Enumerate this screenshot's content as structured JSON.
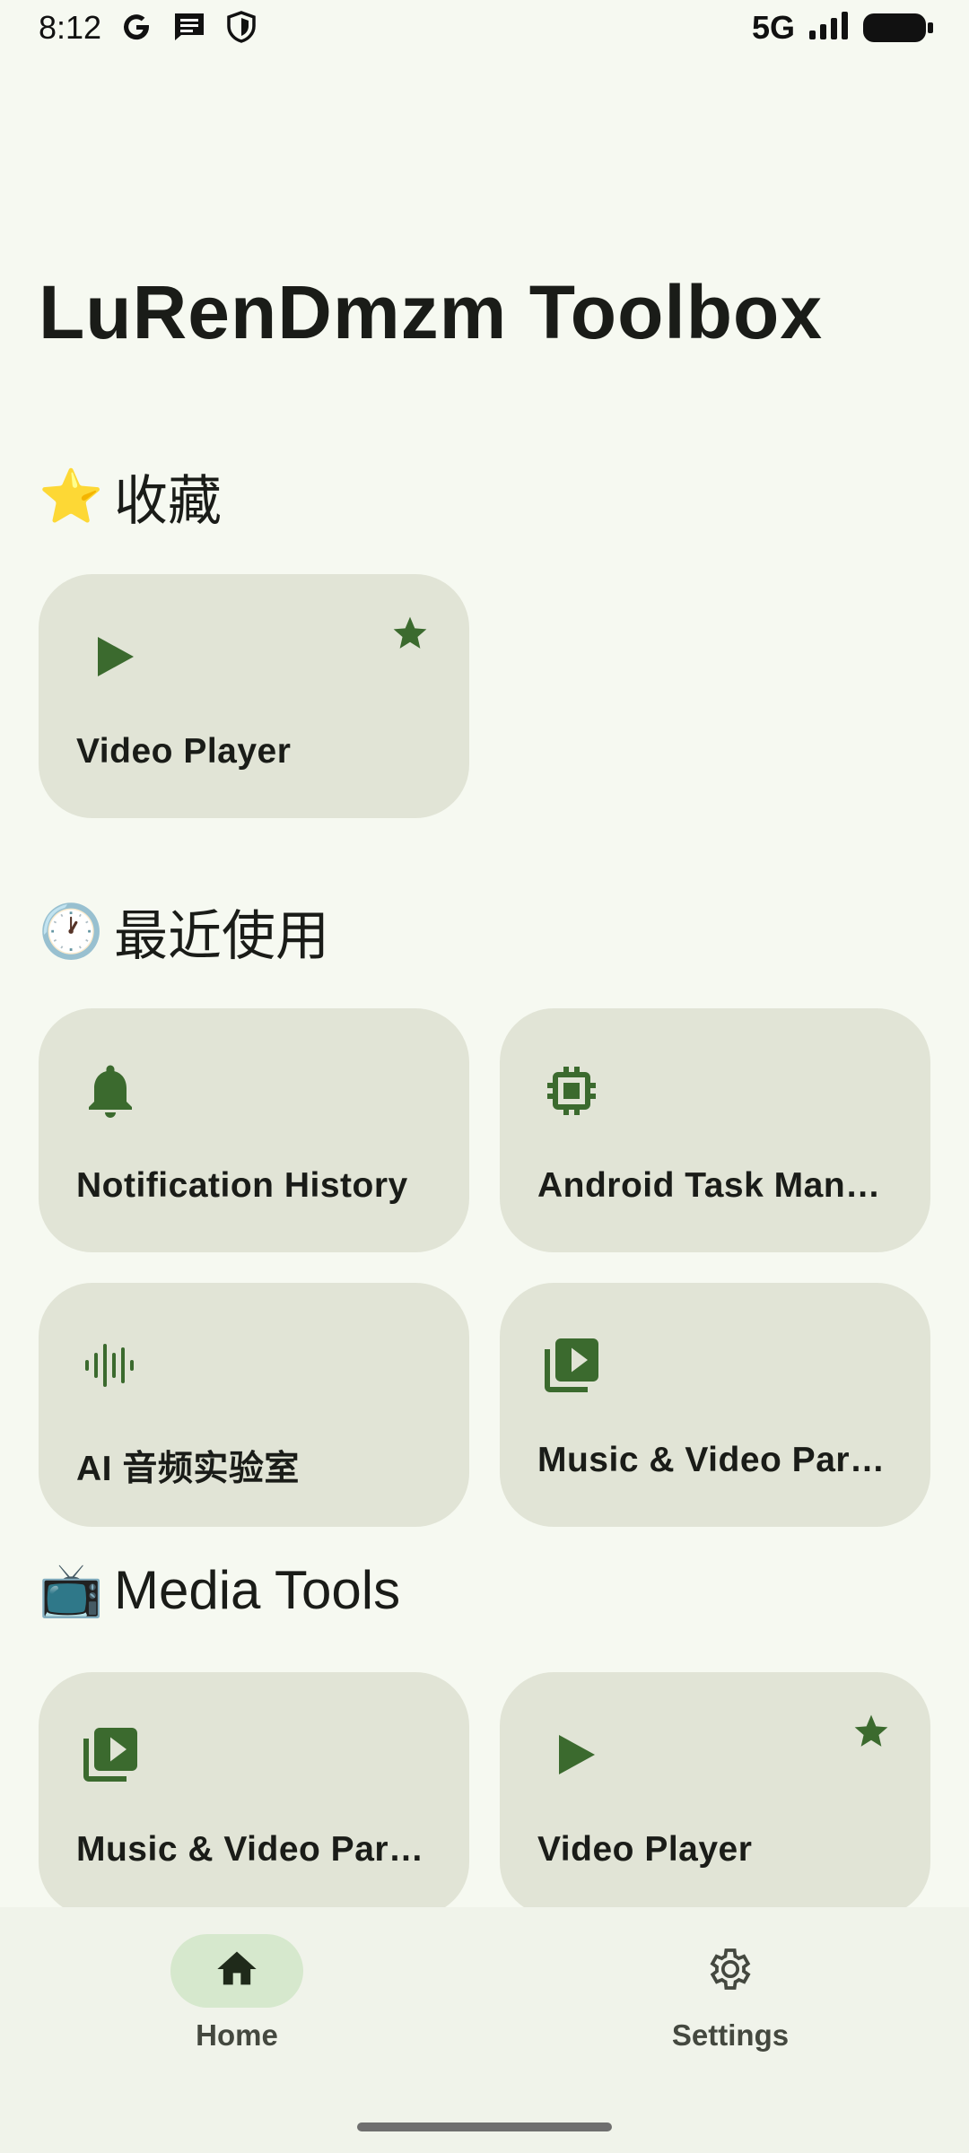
{
  "status_bar": {
    "time": "8:12",
    "network": "5G",
    "icons": [
      "google-g-icon",
      "message-icon",
      "shield-icon",
      "signal-icon",
      "battery-icon"
    ]
  },
  "app": {
    "title": "LuRenDmzm Toolbox"
  },
  "sections": {
    "favorites": {
      "emoji": "⭐",
      "title": "收藏"
    },
    "recent": {
      "emoji": "🕐",
      "title": "最近使用"
    },
    "media": {
      "emoji": "📺",
      "title": "Media Tools"
    }
  },
  "favorites_cards": [
    {
      "label": "Video Player",
      "icon": "play-icon",
      "starred": true
    }
  ],
  "recent_cards": [
    {
      "label": "Notification History",
      "icon": "bell-icon"
    },
    {
      "label": "Android Task Man…",
      "icon": "chip-icon"
    },
    {
      "label": "AI 音频实验室",
      "icon": "audio-wave-icon"
    },
    {
      "label": "Music & Video Par…",
      "icon": "video-library-icon"
    }
  ],
  "media_cards": [
    {
      "label": "Music & Video Par…",
      "icon": "video-library-icon"
    },
    {
      "label": "Video Player",
      "icon": "play-icon",
      "starred": true
    }
  ],
  "bottom_nav": {
    "home_label": "Home",
    "settings_label": "Settings",
    "active": "Home"
  },
  "colors": {
    "background": "#f6f9f1",
    "card": "#e1e4d6",
    "accent": "#3b6a2e",
    "nav_active_pill": "#d6e8cd"
  }
}
